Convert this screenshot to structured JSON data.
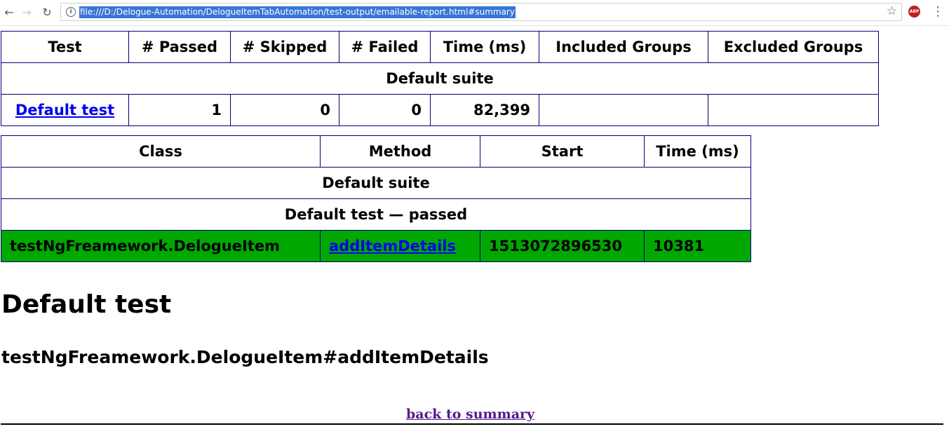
{
  "browser": {
    "url": "file:///D:/Delogue-Automation/DelogueItemTabAutomation/test-output/emailable-report.html#summary",
    "icons": {
      "back": "arrow-left-icon",
      "forward": "arrow-right-icon",
      "reload": "reload-icon",
      "info": "info-icon",
      "bookmark": "star-icon",
      "extension": "adblock-plus-icon",
      "menu": "kebab-menu-icon"
    },
    "abp_label": "ABP"
  },
  "summary": {
    "headers": [
      "Test",
      "# Passed",
      "# Skipped",
      "# Failed",
      "Time (ms)",
      "Included Groups",
      "Excluded Groups"
    ],
    "suite_label": "Default suite",
    "row": {
      "test": "Default test",
      "passed": "1",
      "skipped": "0",
      "failed": "0",
      "time": "82,399",
      "included": "",
      "excluded": ""
    }
  },
  "methods": {
    "headers": [
      "Class",
      "Method",
      "Start",
      "Time (ms)"
    ],
    "suite_label": "Default suite",
    "group_label": "Default test — passed",
    "row": {
      "class": "testNgFreamework.DelogueItem",
      "method": "addItemDetails",
      "start": "1513072896530",
      "time": "10381"
    },
    "row_color": "#00a800"
  },
  "detail": {
    "heading": "Default test",
    "subheading": "testNgFreamework.DelogueItem#addItemDetails",
    "back_link": "back to summary"
  }
}
